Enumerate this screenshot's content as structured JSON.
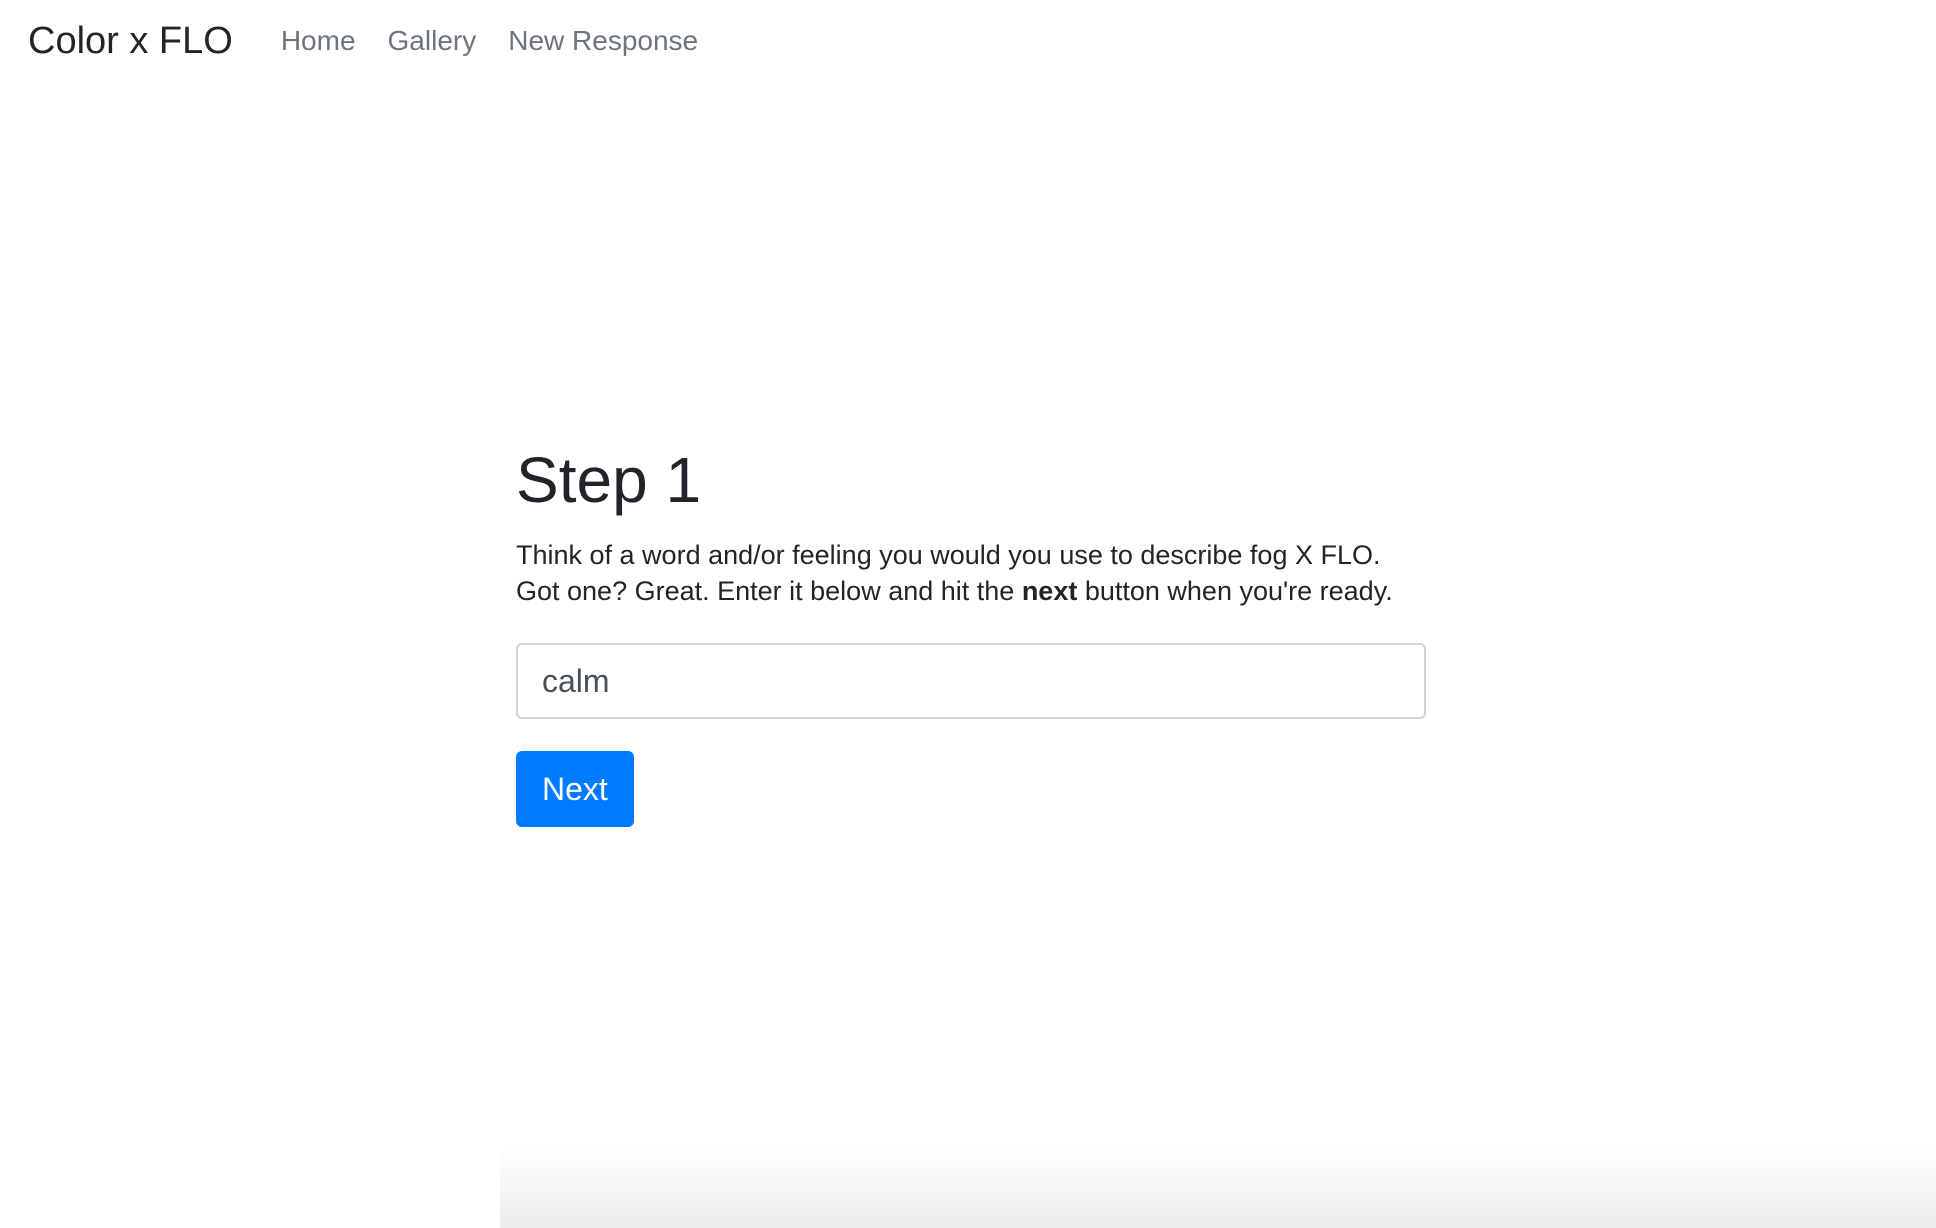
{
  "navbar": {
    "brand": "Color x FLO",
    "links": [
      {
        "label": "Home"
      },
      {
        "label": "Gallery"
      },
      {
        "label": "New Response"
      }
    ]
  },
  "main": {
    "heading": "Step 1",
    "line1": "Think of a word and/or feeling you would you use to describe fog X FLO.",
    "line2_before": "Got one? Great. Enter it below and hit the ",
    "line2_bold": "next",
    "line2_after": " button when you're ready.",
    "input_value": "calm",
    "button_label": "Next"
  },
  "colors": {
    "primary": "#007bff",
    "nav_link": "#6c757d",
    "text": "#212529"
  }
}
